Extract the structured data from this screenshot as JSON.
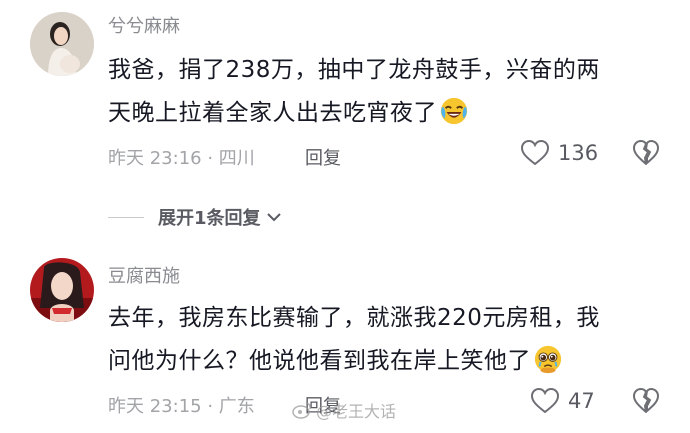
{
  "comments": [
    {
      "username": "兮兮麻麻",
      "text_line1": "我爸，捐了238万，抽中了龙舟鼓手，兴奋的两",
      "text_line2": "天晚上拉着全家人出去吃宵夜了",
      "emoji": "laughing-crying-emoji",
      "time_location": "昨天 23:16 · 四川",
      "reply_label": "回复",
      "likes": "136"
    },
    {
      "username": "豆腐西施",
      "text_line1": "去年，我房东比赛输了，就涨我220元房租，我",
      "text_line2": "问他为什么？他说他看到我在岸上笑他了",
      "emoji": "pleading-face-emoji",
      "time_location": "昨天 23:15 · 广东",
      "reply_label": "回复",
      "likes": "47"
    }
  ],
  "expand_replies": {
    "label": "展开1条回复"
  },
  "watermark": {
    "text": "@老王大话"
  },
  "colors": {
    "primary_text": "#161823",
    "secondary_text": "#8a8b91",
    "meta_text": "#a3a4a8",
    "emoji_yellow": "#f7c52e"
  }
}
